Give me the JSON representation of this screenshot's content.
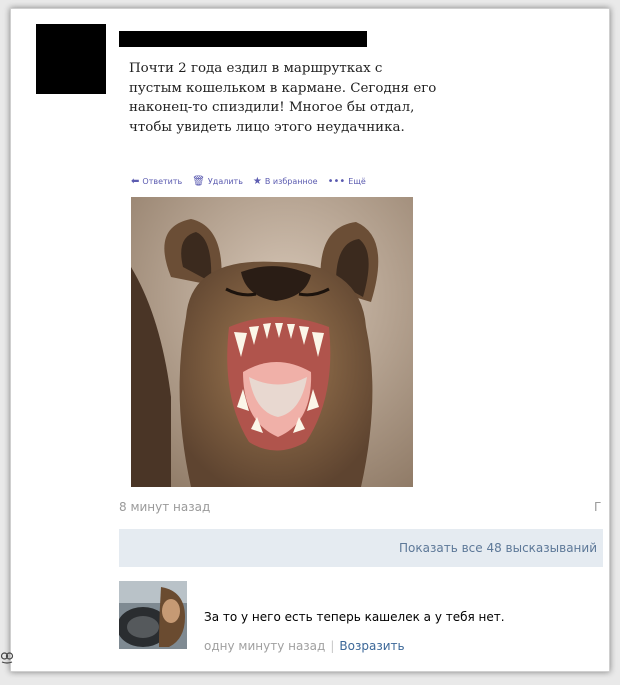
{
  "post": {
    "text_lines": [
      "Почти 2 года ездил в маршрутках с",
      "пустым кошельком в кармане. Сегодня его",
      "наконец-то спиздили! Многое бы отдал,",
      "чтобы увидеть лицо этого неудачника."
    ],
    "actions": {
      "reply": "Ответить",
      "delete": "Удалить",
      "favorite": "В избранное",
      "more": "Ещё"
    },
    "timestamp": "8 минут назад",
    "corner_glyph": "Г"
  },
  "show_all_label": "Показать все 48 высказываний",
  "comment": {
    "text": "За то у него есть теперь кашелек а у тебя нет.",
    "time": "одну минуту назад",
    "separator": "|",
    "reply_link": "Возразить"
  },
  "icons": {
    "reply": "reply-arrow-icon",
    "delete": "trash-icon",
    "favorite": "star-icon",
    "more": "dots-icon",
    "watermark": "owl-icon"
  },
  "colors": {
    "action_link": "#5b5bb0",
    "show_all_bg": "#e5ebf1",
    "show_all_text": "#5d7898",
    "reply_link": "#3b6798"
  }
}
